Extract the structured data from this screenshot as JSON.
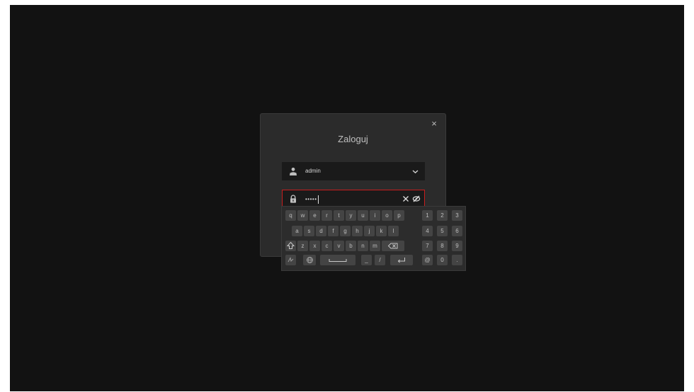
{
  "dialog": {
    "title": "Zaloguj",
    "close_glyph": "×"
  },
  "username": {
    "value": "admin",
    "icon": "user-icon",
    "dropdown_icon": "chevron-down-icon"
  },
  "password": {
    "masked_value": "•••••",
    "icon": "lock-icon",
    "clear_icon": "close-icon",
    "visibility_icon": "eye-off-icon",
    "border_color": "#c81e1e"
  },
  "keyboard": {
    "row1": [
      "q",
      "w",
      "e",
      "r",
      "t",
      "y",
      "u",
      "i",
      "o",
      "p"
    ],
    "row2": [
      "a",
      "s",
      "d",
      "f",
      "g",
      "h",
      "j",
      "k",
      "l"
    ],
    "row3": [
      "z",
      "x",
      "c",
      "v",
      "b",
      "n",
      "m"
    ],
    "row4_symbols": [
      "_",
      "/"
    ],
    "numpad": [
      "1",
      "2",
      "3",
      "4",
      "5",
      "6",
      "7",
      "8",
      "9",
      "@",
      "0",
      "."
    ],
    "special_keys": {
      "shift": "shift-icon",
      "backspace": "backspace-icon",
      "handwriting": "handwriting-icon",
      "language": "globe-icon",
      "space": "space-icon",
      "enter": "enter-icon"
    }
  },
  "colors": {
    "background": "#121212",
    "dialog": "#2b2b2b",
    "field": "#1a1a1a",
    "key": "#444444",
    "accent_error": "#c81e1e"
  }
}
